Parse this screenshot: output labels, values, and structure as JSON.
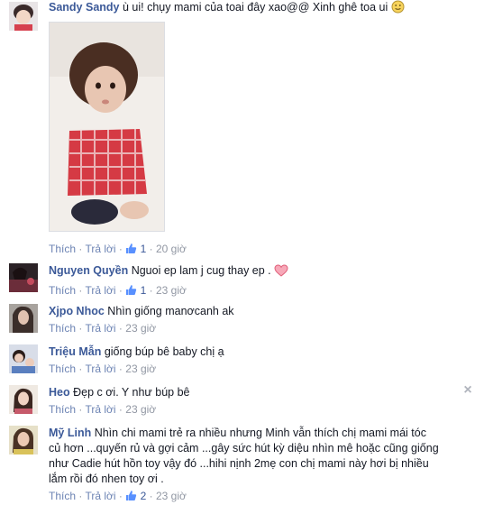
{
  "comments": [
    {
      "author": "Sandy Sandy",
      "text": "ù ui! chụy mami của toai đây xao@@ Xinh ghê toa ui",
      "like": "Thích",
      "reply": "Trả lời",
      "likes": "1",
      "time": "20 giờ"
    },
    {
      "author": "Nguyen Quyền",
      "text": "Nguoi ep lam j cug thay ep .",
      "like": "Thích",
      "reply": "Trả lời",
      "likes": "1",
      "time": "23 giờ"
    },
    {
      "author": "Xjpo Nhoc",
      "text": "Nhìn giống manơcanh ak",
      "like": "Thích",
      "reply": "Trả lời",
      "time": "23 giờ"
    },
    {
      "author": "Triệu Mẫn",
      "text": "giống búp bê baby chị ạ",
      "like": "Thích",
      "reply": "Trả lời",
      "time": "23 giờ"
    },
    {
      "author": "Heo",
      "text": "Đẹp c ơi. Y như búp bê",
      "like": "Thích",
      "reply": "Trả lời",
      "time": "23 giờ"
    },
    {
      "author": "Mỹ Linh",
      "text_lines": [
        "Nhìn chi mami trẻ ra nhiều nhưng Minh vẫn thích chị mami mái tóc",
        "củ hơn ...quyến rủ và gợi cảm ...gây sức hút kỳ diệu nhìn mê hoặc cũng giống",
        "như Cadie hút hồn toy vậy đó ...hihi nịnh 2mẹ con chị mami này hơi bị nhiều",
        "lắm rồi đó nhen toy ơi ."
      ],
      "like": "Thích",
      "reply": "Trả lời",
      "likes": "2",
      "time": "23 giờ"
    }
  ],
  "separator": "·",
  "icons": {
    "like": "thumbs-up-icon",
    "close": "close-icon",
    "emoji": "smiley-icon",
    "heart": "heart-icon"
  },
  "colors": {
    "author": "#3b5998",
    "meta": "#9197a3",
    "link": "#6d84b4"
  }
}
